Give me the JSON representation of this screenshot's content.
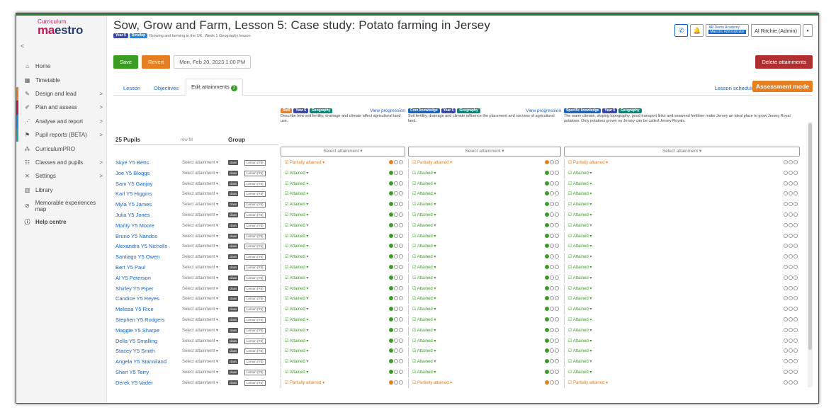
{
  "brand": {
    "line1": "Curriculum",
    "line2_a": "ma",
    "line2_b": "estro"
  },
  "sidebar": {
    "back": "<",
    "items": [
      {
        "label": "Home",
        "icon": "home-icon",
        "glyph": "⌂",
        "chev": "",
        "accent": ""
      },
      {
        "label": "Timetable",
        "icon": "calendar-icon",
        "glyph": "▦",
        "chev": "",
        "accent": ""
      },
      {
        "label": "Design and lead",
        "icon": "design-icon",
        "glyph": "✎",
        "chev": ">",
        "accent": "#e67e22"
      },
      {
        "label": "Plan and assess",
        "icon": "pencil-icon",
        "glyph": "✐",
        "chev": ">",
        "accent": "#c2185b"
      },
      {
        "label": "Analyse and report",
        "icon": "chart-icon",
        "glyph": "⋰",
        "chev": ">",
        "accent": "#1e88e5"
      },
      {
        "label": "Pupil reports (BETA)",
        "icon": "report-icon",
        "glyph": "⚑",
        "chev": ">",
        "accent": "#26a69a"
      },
      {
        "label": "CurriculumPRO",
        "icon": "pro-icon",
        "glyph": "⁂",
        "chev": "",
        "accent": ""
      },
      {
        "label": "Classes and pupils",
        "icon": "users-icon",
        "glyph": "☷",
        "chev": ">",
        "accent": ""
      },
      {
        "label": "Settings",
        "icon": "tools-icon",
        "glyph": "✕",
        "chev": ">",
        "accent": ""
      },
      {
        "label": "Library",
        "icon": "library-icon",
        "glyph": "▥",
        "chev": "",
        "accent": ""
      },
      {
        "label": "Memorable experiences map",
        "icon": "compass-icon",
        "glyph": "⊘",
        "chev": "",
        "accent": ""
      },
      {
        "label": "Help centre",
        "icon": "help-icon",
        "glyph": "ⓘ",
        "chev": "",
        "accent": ""
      }
    ]
  },
  "header": {
    "title": "Sow, Grow and Farm, Lesson 5: Case study: Potato farming in Jersey",
    "chip_year": "Year 5",
    "chip_develop": "Develop",
    "subtitle_text": "Growing and farming in the UK,",
    "subtitle_week": "Week 1 Geography lesson",
    "account_org": "AR Demo Academy",
    "account_role": "Maestro Administrator",
    "user": "Al Ritchie (Admin)",
    "caret": "▾",
    "phone": "✆",
    "bell": "♫"
  },
  "toolbar": {
    "save": "Save",
    "revert": "Revert",
    "date": "Mon, Feb 20, 2023 1:00 PM",
    "delete": "Delete attainments"
  },
  "tabs": {
    "lesson": "Lesson",
    "objectives": "Objectives",
    "edit": "Edit attainments",
    "edit_badge": "3",
    "schedule": "Lesson schedule",
    "assessment": "Assessment mode"
  },
  "table": {
    "pupils_header": "25 Pupils",
    "rowfill": "row fill",
    "group_header": "Group",
    "select_attainment": "Select attainment ▾",
    "objectives": [
      {
        "tags": [
          "Skill",
          "Year 5",
          "Geography"
        ],
        "tag_colors": [
          "#e67e22",
          "#3949ab",
          "#00897b"
        ],
        "progress": "View progression",
        "desc": "Describe how soil fertility, drainage and climate affect agricultural land use."
      },
      {
        "tags": [
          "Core knowledge",
          "Year 5",
          "Geography"
        ],
        "tag_colors": [
          "#1565c0",
          "#3949ab",
          "#00897b"
        ],
        "progress": "View progression",
        "desc": "Soil fertility, drainage and climate influence the placement and success of agricultural land."
      },
      {
        "tags": [
          "Specific knowledge",
          "Year 5",
          "Geography"
        ],
        "tag_colors": [
          "#1565c0",
          "#3949ab",
          "#00897b"
        ],
        "progress": "",
        "desc": "The warm climate, sloping topography, good transport links and seaweed fertiliser make Jersey an ideal place to grow Jersey Royal potatoes. Only potatoes grown on Jersey can be called Jersey Royals."
      }
    ],
    "class_chip": "class",
    "group_chip": "Lemon (Y5)",
    "attained": "Attained",
    "partially": "Partially attained",
    "pupils": [
      {
        "name": "Skye Y5 Betts",
        "status": "partial"
      },
      {
        "name": "Joe Y5 Bloggs",
        "status": "attained"
      },
      {
        "name": "Sam Y5 Ganjay",
        "status": "attained"
      },
      {
        "name": "Karl Y5 Higgins",
        "status": "attained"
      },
      {
        "name": "Myla Y5 James",
        "status": "attained"
      },
      {
        "name": "Julia Y5 Jones",
        "status": "attained"
      },
      {
        "name": "Monty Y5 Moore",
        "status": "attained"
      },
      {
        "name": "Bruno Y5 Nandos",
        "status": "attained"
      },
      {
        "name": "Alexandra Y5 Nicholls",
        "status": "attained"
      },
      {
        "name": "Santiago Y5 Owen",
        "status": "attained"
      },
      {
        "name": "Bert Y5 Paul",
        "status": "attained"
      },
      {
        "name": "Al Y5 Peterson",
        "status": "attained"
      },
      {
        "name": "Shirley Y5 Piper",
        "status": "attained"
      },
      {
        "name": "Candice Y5 Reyes",
        "status": "attained"
      },
      {
        "name": "Melissa Y5 Rice",
        "status": "attained"
      },
      {
        "name": "Stephen Y5 Rodgers",
        "status": "attained"
      },
      {
        "name": "Maggie Y5 Sharpe",
        "status": "attained"
      },
      {
        "name": "Della Y5 Smalling",
        "status": "attained"
      },
      {
        "name": "Stacey Y5 Smith",
        "status": "attained"
      },
      {
        "name": "Angela Y5 Stanniland",
        "status": "attained"
      },
      {
        "name": "Sheri Y5 Terry",
        "status": "attained"
      },
      {
        "name": "Derek Y5 Vader",
        "status": "partial"
      }
    ]
  },
  "colors": {
    "attained": "#3a9d23",
    "partial": "#e67e22",
    "link": "#1565c0"
  }
}
